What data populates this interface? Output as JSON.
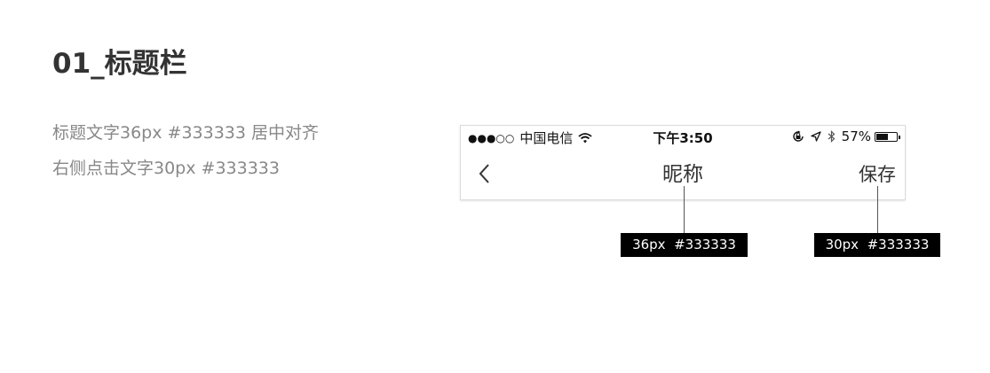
{
  "section": {
    "title": "01_标题栏"
  },
  "description": {
    "line1": "标题文字36px #333333 居中对齐",
    "line2": "右侧点击文字30px #333333"
  },
  "status_bar": {
    "signal": "●●●○○",
    "carrier": "中国电信",
    "time": "下午3:50",
    "battery_percent": "57%",
    "battery_level": 0.57,
    "icons": [
      "wifi-icon",
      "orientation-lock-icon",
      "location-icon",
      "bluetooth-icon",
      "battery-icon"
    ]
  },
  "nav_bar": {
    "back_icon": "chevron-left-icon",
    "title": "昵称",
    "right_action": "保存"
  },
  "annotations": {
    "title_spec": "36px  #333333",
    "action_spec": "30px  #333333"
  },
  "colors": {
    "text_primary": "#333333",
    "annotation_bg": "#000000",
    "annotation_text": "#ffffff"
  }
}
